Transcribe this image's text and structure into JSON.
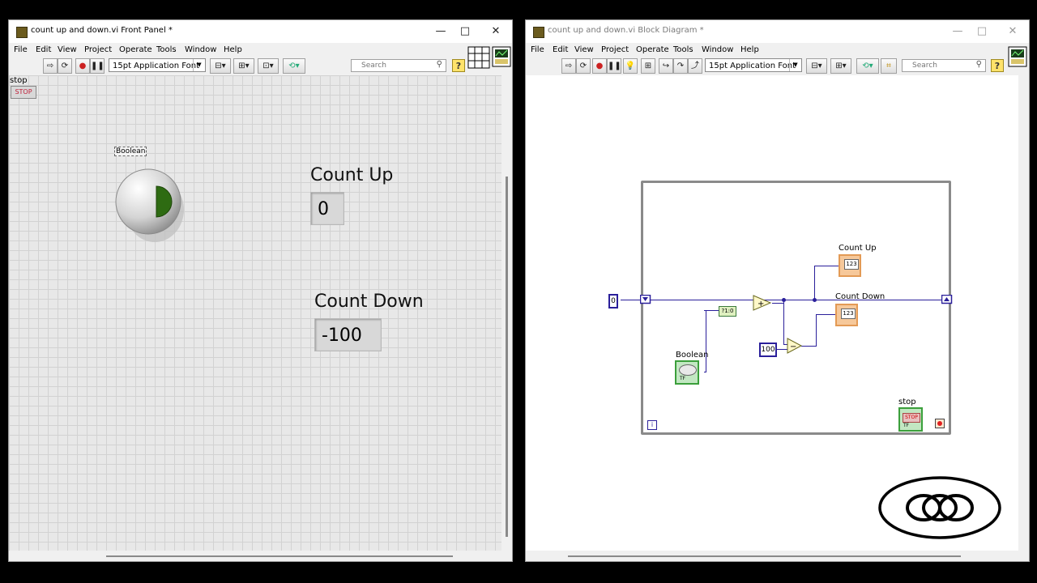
{
  "front_panel": {
    "title": "count up and down.vi Front Panel *",
    "win_controls": {
      "minimize": "—",
      "maximize": "□",
      "close": "✕"
    },
    "menu": [
      "File",
      "Edit",
      "View",
      "Project",
      "Operate",
      "Tools",
      "Window",
      "Help"
    ],
    "font_selector": "15pt Application Font",
    "search_placeholder": "Search",
    "help_label": "?",
    "stop_label": "stop",
    "stop_button_text": "STOP",
    "boolean_label": "Boolean",
    "count_up": {
      "label": "Count Up",
      "value": "0"
    },
    "count_down": {
      "label": "Count Down",
      "value": "-100"
    }
  },
  "block_diagram": {
    "title": "count up and down.vi Block Diagram *",
    "win_controls": {
      "minimize": "—",
      "maximize": "□",
      "close": "✕"
    },
    "menu": [
      "File",
      "Edit",
      "View",
      "Project",
      "Operate",
      "Tools",
      "Window",
      "Help"
    ],
    "font_selector": "15pt Application Font",
    "search_placeholder": "Search",
    "help_label": "?",
    "nodes": {
      "init_const": "0",
      "const_100": "100",
      "count_up_label": "Count Up",
      "count_down_label": "Count Down",
      "boolean_label": "Boolean",
      "stop_label": "stop",
      "stop_text": "STOP",
      "indicator_text": "123",
      "bool_type": "TF",
      "iteration": "i",
      "convert": "?1:0"
    }
  },
  "colors": {
    "wire": "#2a1f9a",
    "boolean_green": "#3b9f3b",
    "numeric_orange": "#e39a55",
    "stop_red": "#d04040"
  }
}
